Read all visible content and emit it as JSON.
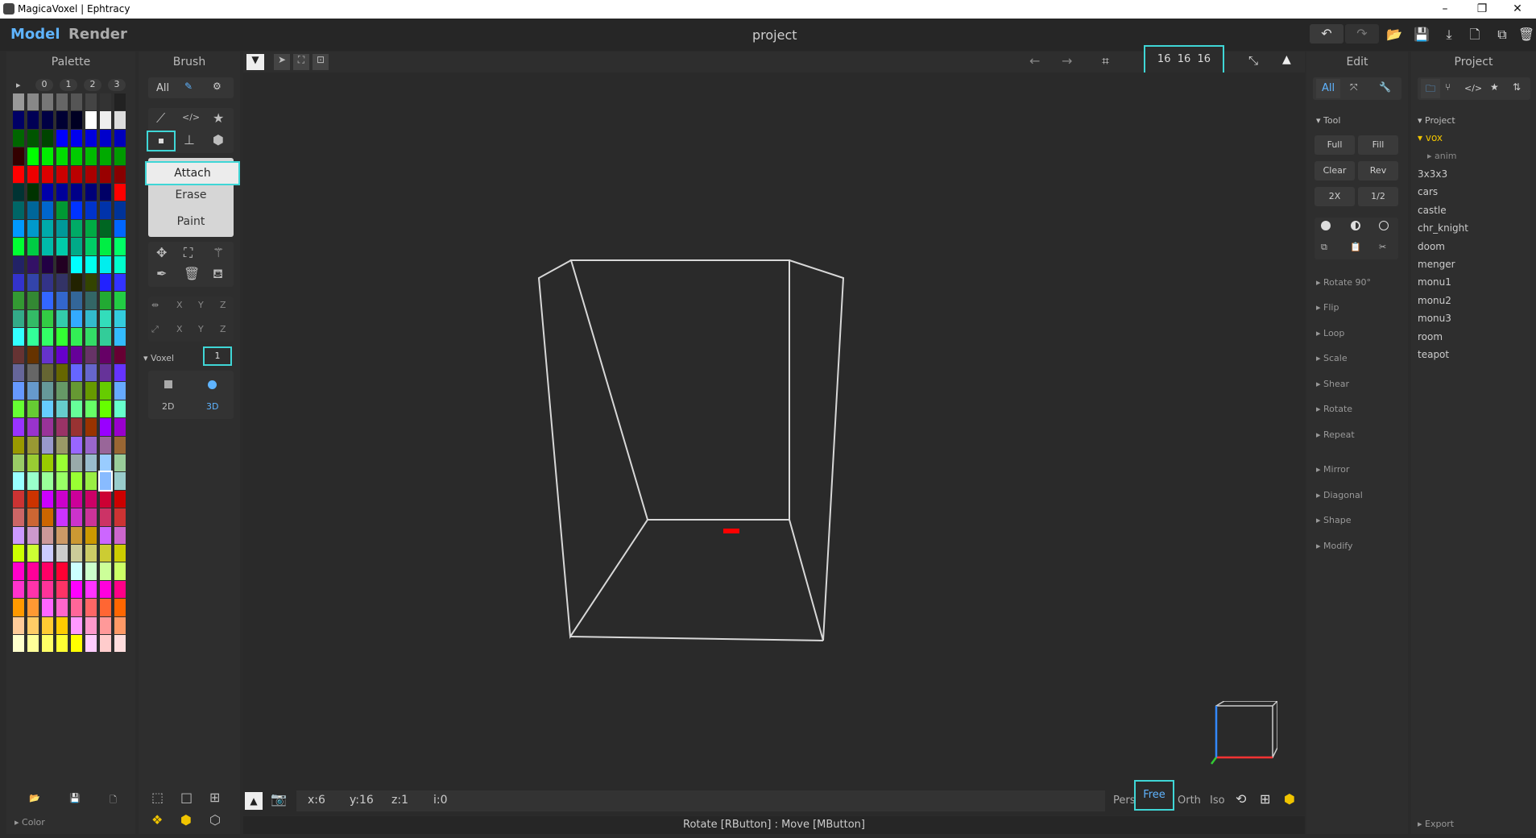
{
  "window": {
    "title": "MagicaVoxel | Ephtracy",
    "min": "–",
    "max": "❐",
    "close": "✕"
  },
  "topbar": {
    "tabs": [
      "Model",
      "Render"
    ],
    "project": "project"
  },
  "palette": {
    "title": "Palette",
    "pages": [
      "▸",
      "0",
      "1",
      "2",
      "3"
    ],
    "footer": "Color",
    "colors": [
      "#999999",
      "#888888",
      "#777777",
      "#666666",
      "#555555",
      "#444444",
      "#333333",
      "#222222",
      "#000066",
      "#000055",
      "#000044",
      "#000033",
      "#000022",
      "#ffffff",
      "#eeeeee",
      "#dddddd",
      "#006600",
      "#005500",
      "#004400",
      "#0000ff",
      "#0000ee",
      "#0000dd",
      "#0000cc",
      "#0000bb",
      "#330000",
      "#00ff00",
      "#00ee00",
      "#00dd00",
      "#00cc00",
      "#00bb00",
      "#00aa00",
      "#009900",
      "#ff0000",
      "#ee0000",
      "#dd0000",
      "#cc0000",
      "#bb0000",
      "#aa0000",
      "#990000",
      "#880000",
      "#003333",
      "#003300",
      "#0000aa",
      "#000099",
      "#000088",
      "#000077",
      "#000066",
      "#ff0000",
      "#006666",
      "#006699",
      "#0066cc",
      "#009933",
      "#0033ff",
      "#0033cc",
      "#0033aa",
      "#003399",
      "#0099ff",
      "#0099cc",
      "#00aaaa",
      "#009999",
      "#00aa66",
      "#00aa44",
      "#006622",
      "#0066ff",
      "#00ff33",
      "#00cc44",
      "#00bbaa",
      "#00ccaa",
      "#00aa88",
      "#00cc66",
      "#00ee44",
      "#00ff66",
      "#222266",
      "#331166",
      "#220044",
      "#220022",
      "#00ffff",
      "#00ffee",
      "#00eeee",
      "#00ffcc",
      "#3333cc",
      "#3344aa",
      "#333388",
      "#333366",
      "#222200",
      "#334400",
      "#2222ff",
      "#3333ff",
      "#339933",
      "#338833",
      "#3366ff",
      "#3366cc",
      "#336699",
      "#336666",
      "#22aa33",
      "#22cc44",
      "#33aa88",
      "#33bb66",
      "#33cc44",
      "#33ccaa",
      "#33aaff",
      "#33bbcc",
      "#33ddbb",
      "#33ccdd",
      "#33ffff",
      "#33ff99",
      "#33ff66",
      "#33ff33",
      "#33ee55",
      "#33dd66",
      "#33cc99",
      "#33bbff",
      "#663333",
      "#663300",
      "#6633cc",
      "#6600cc",
      "#660099",
      "#663366",
      "#660066",
      "#660033",
      "#666699",
      "#666666",
      "#666633",
      "#666600",
      "#6666ff",
      "#6666cc",
      "#663399",
      "#6633ff",
      "#6699ff",
      "#6699cc",
      "#669999",
      "#669966",
      "#669933",
      "#669900",
      "#66cc00",
      "#66aaff",
      "#66ff33",
      "#66cc33",
      "#66ccff",
      "#66cccc",
      "#66ff99",
      "#66ff66",
      "#66ff00",
      "#66ffcc",
      "#9933ff",
      "#9933cc",
      "#993399",
      "#993366",
      "#993333",
      "#993300",
      "#9900ff",
      "#9900cc",
      "#999900",
      "#999933",
      "#9999cc",
      "#999966",
      "#9966ff",
      "#9966cc",
      "#996699",
      "#996633",
      "#99cc66",
      "#99cc33",
      "#99cc00",
      "#99ff33",
      "#99aaaa",
      "#99bbcc",
      "#99ccff",
      "#99cc99",
      "#99ffff",
      "#99ffcc",
      "#99ff99",
      "#99ff66",
      "#99ff33",
      "#99ee44",
      "#88bbff",
      "#99cccc",
      "#cc3333",
      "#cc3300",
      "#cc00ff",
      "#cc00cc",
      "#cc0099",
      "#cc0066",
      "#cc0033",
      "#cc0000",
      "#cc6666",
      "#cc6633",
      "#cc6600",
      "#cc33ff",
      "#cc33cc",
      "#cc3399",
      "#cc3366",
      "#cc3333",
      "#cc99ff",
      "#cc99cc",
      "#cc9999",
      "#cc9966",
      "#cc9933",
      "#cc9900",
      "#cc66ff",
      "#cc66cc",
      "#ccff00",
      "#ccff33",
      "#ccccff",
      "#cccccc",
      "#cccc99",
      "#cccc66",
      "#cccc33",
      "#cccc00",
      "#ff00cc",
      "#ff0099",
      "#ff0066",
      "#ff0033",
      "#ccffff",
      "#ccffcc",
      "#ccff99",
      "#ccff66",
      "#ff33cc",
      "#ff33aa",
      "#ff3399",
      "#ff3366",
      "#ff00ff",
      "#ff33ff",
      "#ff00dd",
      "#ff0088",
      "#ff9900",
      "#ff9933",
      "#ff66ff",
      "#ff66cc",
      "#ff6699",
      "#ff6666",
      "#ff6633",
      "#ff6600",
      "#ffcc99",
      "#ffcc66",
      "#ffcc33",
      "#ffcc00",
      "#ff99ff",
      "#ff99cc",
      "#ff9999",
      "#ff9966",
      "#ffffcc",
      "#ffff99",
      "#ffff66",
      "#ffff33",
      "#ffff00",
      "#ffccff",
      "#ffcccc",
      "#ffdddd"
    ]
  },
  "brush": {
    "title": "Brush",
    "tab_all": "All",
    "modes": [
      "Attach",
      "Erase",
      "Paint"
    ],
    "axes1": [
      "X",
      "Y",
      "Z"
    ],
    "axes2": [
      "X",
      "Y",
      "Z"
    ],
    "voxel_label": "Voxel",
    "voxel_value": "1",
    "dim2": "2D",
    "dim3": "3D"
  },
  "viewport": {
    "size_input": "16  16  16",
    "coords": {
      "x": "x:6",
      "y": "y:16",
      "z": "z:1",
      "i": "i:0"
    },
    "views": [
      "Pers",
      "Free",
      "Orth",
      "Iso"
    ],
    "status": "Rotate [RButton] : Move [MButton]",
    "accent": "#ff0000"
  },
  "edit": {
    "title": "Edit",
    "tab_all": "All",
    "tool_label": "Tool",
    "tool_buttons": [
      "Full",
      "Fill",
      "Clear",
      "Rev",
      "2X",
      "1/2"
    ],
    "sections": [
      "Rotate 90°",
      "Flip",
      "Loop",
      "Scale",
      "Shear",
      "Rotate",
      "Repeat",
      "Mirror",
      "Diagonal",
      "Shape",
      "Modify"
    ]
  },
  "project": {
    "title": "Project",
    "section": "Project",
    "folder": "vox",
    "subfolder": "anim",
    "files": [
      "3x3x3",
      "cars",
      "castle",
      "chr_knight",
      "doom",
      "menger",
      "monu1",
      "monu2",
      "monu3",
      "room",
      "teapot"
    ],
    "export": "Export",
    "accent": "#f0c400"
  }
}
